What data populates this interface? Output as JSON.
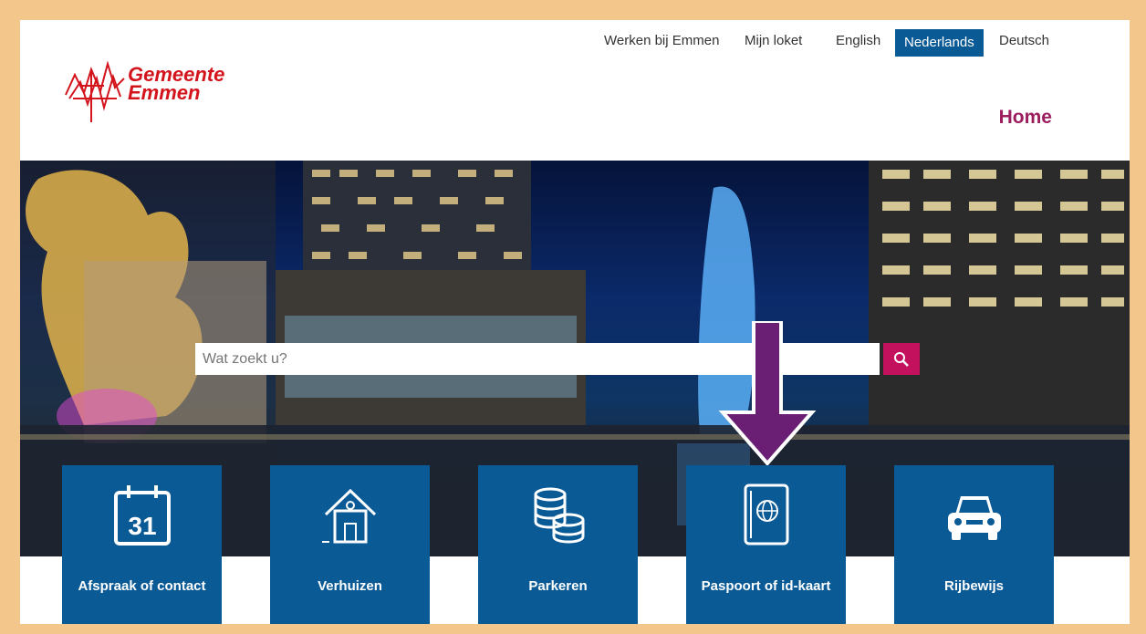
{
  "header": {
    "top_links": [
      "Werken bij Emmen",
      "Mijn loket"
    ],
    "languages": [
      "English",
      "Nederlands",
      "Deutsch"
    ],
    "active_language": "Nederlands",
    "logo_line1": "Gemeente",
    "logo_line2": "Emmen",
    "page_title": "Home"
  },
  "search": {
    "placeholder": "Wat zoekt u?"
  },
  "tiles": [
    {
      "label": "Afspraak of contact",
      "icon": "calendar-icon",
      "icon_text": "31"
    },
    {
      "label": "Verhuizen",
      "icon": "house-icon"
    },
    {
      "label": "Parkeren",
      "icon": "coins-icon"
    },
    {
      "label": "Paspoort of id-kaart",
      "icon": "passport-icon"
    },
    {
      "label": "Rijbewijs",
      "icon": "car-icon"
    }
  ],
  "colors": {
    "accent_blue": "#0a5a96",
    "brand_red": "#d4141c",
    "title_purple": "#9d1e5f",
    "search_button": "#c4115e",
    "annotation_arrow": "#6a1e74",
    "frame": "#f3c68c"
  }
}
